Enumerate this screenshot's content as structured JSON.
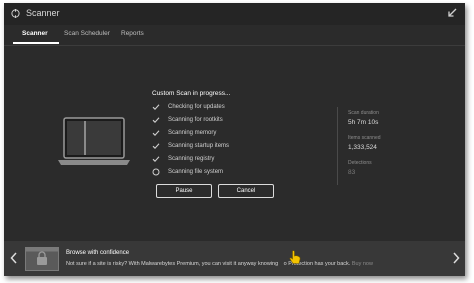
{
  "window": {
    "title": "Scanner"
  },
  "icons": {
    "app": "malwarebytes-logo-icon",
    "back": "back-arrow-icon",
    "step_done": "checkmark-icon",
    "step_active": "spinner-icon",
    "cursor": "hand-pointer-icon"
  },
  "tabs": [
    {
      "label": "Scanner",
      "active": true
    },
    {
      "label": "Scan Scheduler",
      "active": false
    },
    {
      "label": "Reports",
      "active": false
    }
  ],
  "scan": {
    "status": "Custom Scan in progress...",
    "steps": [
      {
        "label": "Checking for updates",
        "state": "done"
      },
      {
        "label": "Scanning for rootkits",
        "state": "done"
      },
      {
        "label": "Scanning memory",
        "state": "done"
      },
      {
        "label": "Scanning startup items",
        "state": "done"
      },
      {
        "label": "Scanning registry",
        "state": "done"
      },
      {
        "label": "Scanning file system",
        "state": "in-progress"
      }
    ],
    "pause_label": "Pause",
    "cancel_label": "Cancel"
  },
  "stats": {
    "duration_label": "Scan duration",
    "duration_value": "5h 7m 10s",
    "items_label": "Items scanned",
    "items_value": "1,333,524",
    "detections_label": "Detections",
    "detections_value": "83"
  },
  "banner": {
    "title": "Browse with confidence",
    "text_before_cursor": "Not sure if a site is risky? With Malwarebytes Premium, you can visit it anyway knowing",
    "text_after_cursor": "o Protection has your back.",
    "link": "Buy now"
  },
  "colors": {
    "background": "#2b2b2b",
    "titlebar": "#252525",
    "banner": "#383838",
    "accent_cursor": "#f2c200"
  }
}
